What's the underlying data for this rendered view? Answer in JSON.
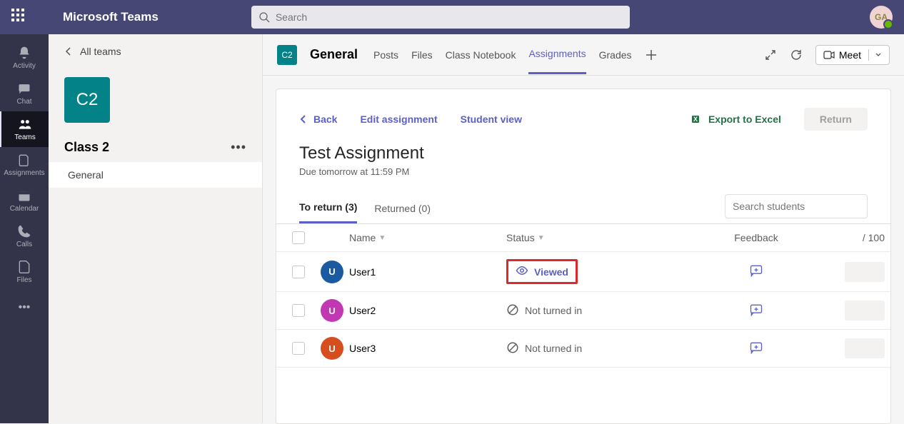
{
  "app": {
    "name": "Microsoft Teams",
    "avatar_initials": "GA"
  },
  "search": {
    "placeholder": "Search"
  },
  "rail": [
    {
      "icon": "bell",
      "label": "Activity"
    },
    {
      "icon": "chat",
      "label": "Chat"
    },
    {
      "icon": "teams",
      "label": "Teams",
      "selected": true
    },
    {
      "icon": "assign",
      "label": "Assignments"
    },
    {
      "icon": "calendar",
      "label": "Calendar"
    },
    {
      "icon": "call",
      "label": "Calls"
    },
    {
      "icon": "files",
      "label": "Files"
    }
  ],
  "panel": {
    "all_teams": "All teams",
    "team_abbrev": "C2",
    "team_name": "Class 2",
    "channels": [
      {
        "label": "General",
        "selected": true
      }
    ]
  },
  "header": {
    "chip": "C2",
    "channel": "General",
    "tabs": [
      {
        "label": "Posts"
      },
      {
        "label": "Files"
      },
      {
        "label": "Class Notebook"
      },
      {
        "label": "Assignments",
        "active": true
      },
      {
        "label": "Grades"
      }
    ],
    "meet": "Meet"
  },
  "assignment": {
    "back": "Back",
    "edit": "Edit assignment",
    "student_view": "Student view",
    "export": "Export to Excel",
    "return": "Return",
    "title": "Test Assignment",
    "due": "Due tomorrow at 11:59 PM",
    "filter_tabs": {
      "to_return": "To return (3)",
      "returned": "Returned (0)"
    },
    "search_placeholder": "Search students",
    "columns": {
      "name": "Name",
      "status": "Status",
      "feedback": "Feedback",
      "score": "/ 100"
    },
    "rows": [
      {
        "initial": "U",
        "color": "c1",
        "name": "User1",
        "status": "Viewed",
        "status_icon": "eye",
        "highlight": true
      },
      {
        "initial": "U",
        "color": "c2",
        "name": "User2",
        "status": "Not turned in",
        "status_icon": "ban"
      },
      {
        "initial": "U",
        "color": "c3",
        "name": "User3",
        "status": "Not turned in",
        "status_icon": "ban"
      }
    ]
  }
}
